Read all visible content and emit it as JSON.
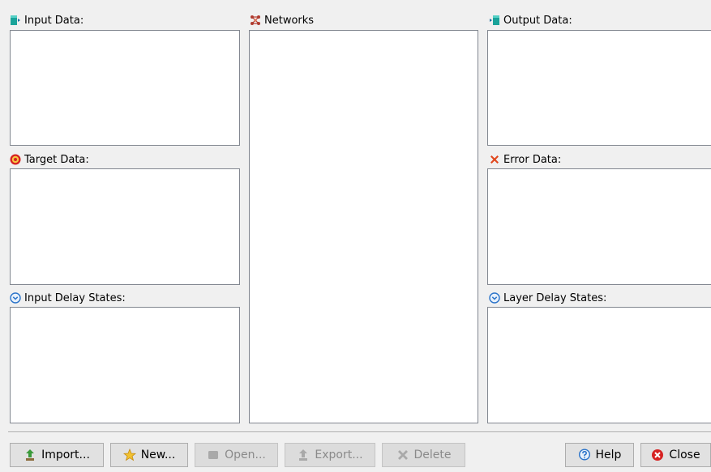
{
  "panels": {
    "input_data": {
      "label": "Input Data:"
    },
    "target_data": {
      "label": "Target Data:"
    },
    "input_delay_states": {
      "label": "Input Delay States:"
    },
    "networks": {
      "label": "Networks"
    },
    "output_data": {
      "label": "Output Data:"
    },
    "error_data": {
      "label": "Error Data:"
    },
    "layer_delay_states": {
      "label": "Layer Delay States:"
    }
  },
  "buttons": {
    "import": {
      "label": "Import...",
      "enabled": true
    },
    "new": {
      "label": "New...",
      "enabled": true
    },
    "open": {
      "label": "Open...",
      "enabled": false
    },
    "export": {
      "label": "Export...",
      "enabled": false
    },
    "delete": {
      "label": "Delete",
      "enabled": false
    },
    "help": {
      "label": "Help",
      "enabled": true
    },
    "close": {
      "label": "Close",
      "enabled": true
    }
  },
  "icons": {
    "input_data": "input-data-icon",
    "target_data": "target-icon",
    "input_delay_states": "clock-icon",
    "networks": "network-icon",
    "output_data": "output-data-icon",
    "error_data": "error-x-icon",
    "layer_delay_states": "clock-icon",
    "import": "import-arrow-icon",
    "new": "new-star-icon",
    "open": "open-icon",
    "export": "export-arrow-icon",
    "delete": "delete-x-icon",
    "help": "help-icon",
    "close": "close-icon"
  },
  "colors": {
    "background": "#f0f0f0",
    "list_background": "#ffffff",
    "list_border": "#828790",
    "button_face": "#e1e1e1",
    "disabled_text": "#8a8a8a",
    "input_icon": "#1aa39a",
    "target_icon": "#d62222",
    "error_icon": "#e0461c",
    "clock_icon": "#2a73c9",
    "network_icon": "#b03a2e"
  }
}
